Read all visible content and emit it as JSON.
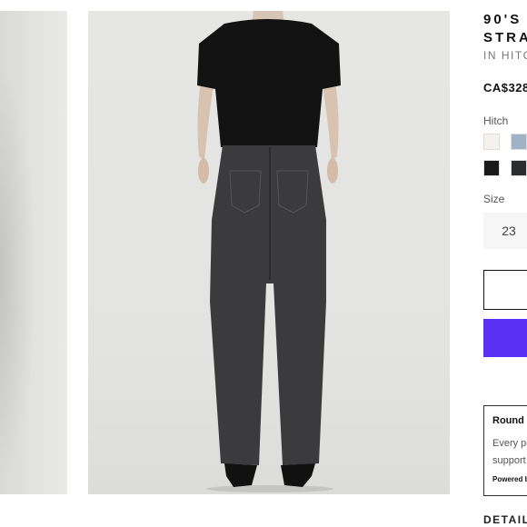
{
  "product": {
    "title_line1": "90'S I",
    "title_line2": "STRA",
    "subtitle": "IN HITC",
    "price": "CA$328"
  },
  "color": {
    "label": "Hitch",
    "swatches": [
      {
        "name": "ecru",
        "hex": "#f5f1ec"
      },
      {
        "name": "light-blue",
        "hex": "#9fb2c6"
      },
      {
        "name": "black",
        "hex": "#1a1a1a"
      },
      {
        "name": "washed-black",
        "hex": "#2a2c30"
      }
    ]
  },
  "size": {
    "label": "Size",
    "selected": "23"
  },
  "buttons": {
    "pay_color": "#5a31f4"
  },
  "promo": {
    "title": "Round",
    "line1": "Every pe",
    "line2": "support",
    "powered": "Powered b"
  },
  "details": {
    "label": "DETAILS"
  }
}
